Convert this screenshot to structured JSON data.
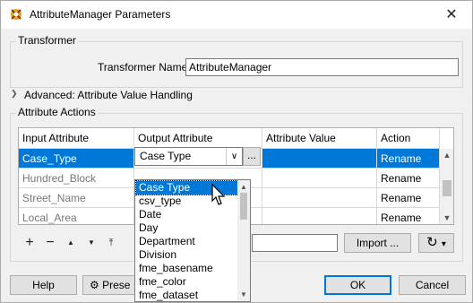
{
  "window": {
    "title": "AttributeManager Parameters",
    "close_glyph": "✕"
  },
  "transformer": {
    "group_label": "Transformer",
    "name_label": "Transformer Name:",
    "name_value": "AttributeManager"
  },
  "advanced": {
    "label": "Advanced: Attribute Value Handling"
  },
  "actions": {
    "group_label": "Attribute Actions",
    "columns": [
      "Input Attribute",
      "Output Attribute",
      "Attribute Value",
      "Action"
    ],
    "rows": [
      {
        "input": "Case_Type",
        "output": "Case Type",
        "value": "",
        "action": "Rename"
      },
      {
        "input": "Hundred_Block",
        "output": "",
        "value": "",
        "action": "Rename"
      },
      {
        "input": "Street_Name",
        "output": "",
        "value": "",
        "action": "Rename"
      },
      {
        "input": "Local_Area",
        "output": "",
        "value": "",
        "action": "Rename"
      }
    ],
    "ellipsis": "...",
    "dropdown_options": [
      "Case Type",
      "csv_type",
      "Date",
      "Day",
      "Department",
      "Division",
      "fme_basename",
      "fme_color",
      "fme_dataset"
    ],
    "selected_option": "Case Type"
  },
  "toolbar": {
    "add_glyph": "+",
    "remove_glyph": "−",
    "up_glyph": "▲",
    "down_glyph": "▼",
    "top_glyph": "⤒",
    "import_label": "Import ...",
    "refresh_glyph": "↻",
    "refresh_menu_glyph": "▾"
  },
  "footer": {
    "help_label": "Help",
    "presets_label": "Prese",
    "ok_label": "OK",
    "cancel_label": "Cancel"
  },
  "colors": {
    "selection": "#0078d7",
    "accent": "#0078d7"
  }
}
